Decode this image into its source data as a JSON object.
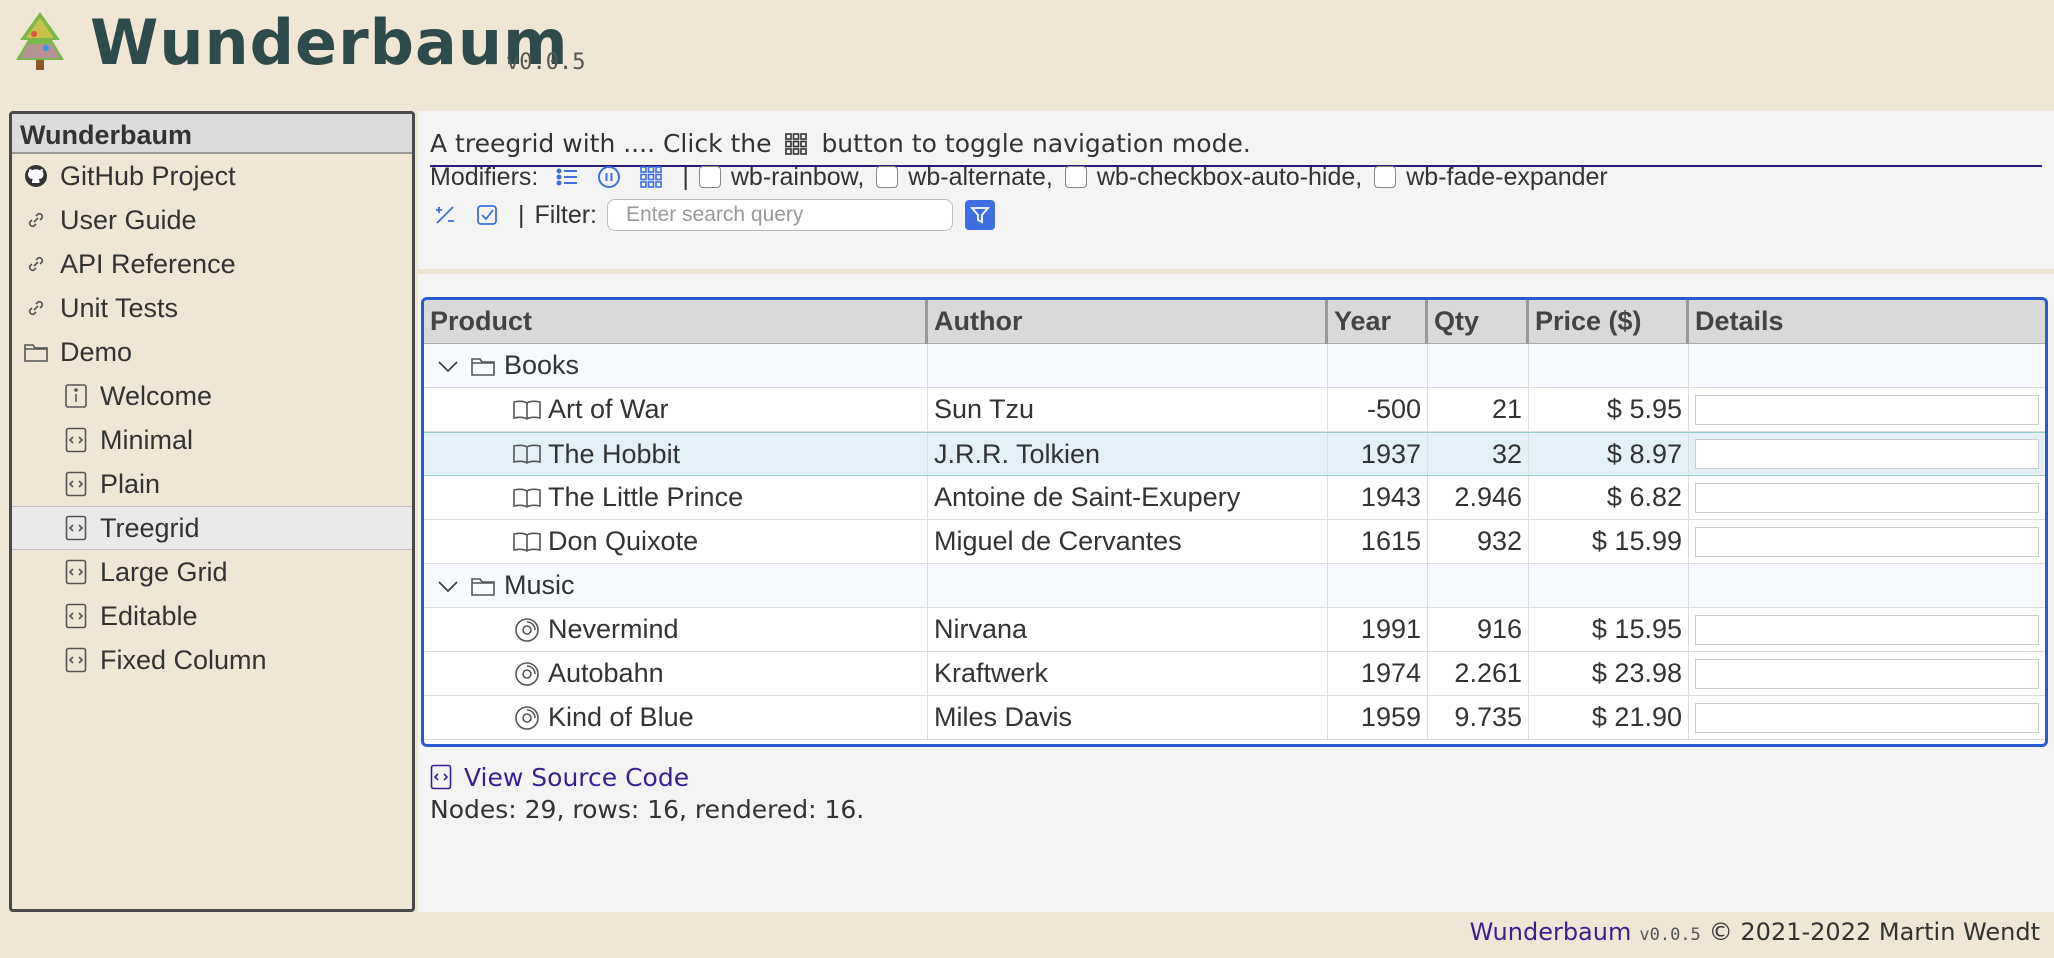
{
  "header": {
    "title": "Wunderbaum",
    "version": "v0.0.5"
  },
  "sidebar": {
    "title": "Wunderbaum",
    "items": [
      {
        "label": "GitHub Project",
        "icon": "github-icon",
        "level": 0
      },
      {
        "label": "User Guide",
        "icon": "link-icon",
        "level": 0
      },
      {
        "label": "API Reference",
        "icon": "link-icon",
        "level": 0
      },
      {
        "label": "Unit Tests",
        "icon": "link-icon",
        "level": 0
      },
      {
        "label": "Demo",
        "icon": "folder-icon",
        "level": 0
      },
      {
        "label": "Welcome",
        "icon": "info-icon",
        "level": 1
      },
      {
        "label": "Minimal",
        "icon": "code-file-icon",
        "level": 1
      },
      {
        "label": "Plain",
        "icon": "code-file-icon",
        "level": 1
      },
      {
        "label": "Treegrid",
        "icon": "code-file-icon",
        "level": 1,
        "active": true
      },
      {
        "label": "Large Grid",
        "icon": "code-file-icon",
        "level": 1
      },
      {
        "label": "Editable",
        "icon": "code-file-icon",
        "level": 1
      },
      {
        "label": "Fixed Column",
        "icon": "code-file-icon",
        "level": 1
      }
    ]
  },
  "main": {
    "intro_before": "A treegrid with .... Click the",
    "intro_after": "button to toggle navigation mode.",
    "modifiers_label": "Modifiers:",
    "separator": "|",
    "checkboxes": [
      "wb-rainbow,",
      "wb-alternate,",
      "wb-checkbox-auto-hide,",
      "wb-fade-expander"
    ],
    "filter_label": "Filter:",
    "search_placeholder": "Enter search query",
    "source_link": "View Source Code",
    "stats": "Nodes: 29, rows: 16, rendered: 16."
  },
  "grid": {
    "columns": [
      "Product",
      "Author",
      "Year",
      "Qty",
      "Price ($)",
      "Details"
    ],
    "rows": [
      {
        "type": "folder",
        "product": "Books",
        "icon": "folder-icon"
      },
      {
        "type": "item",
        "product": "Art of War",
        "author": "Sun Tzu",
        "year": "-500",
        "qty": "21",
        "price": "$ 5.95",
        "icon": "book-icon"
      },
      {
        "type": "item",
        "product": "The Hobbit",
        "author": "J.R.R. Tolkien",
        "year": "1937",
        "qty": "32",
        "price": "$ 8.97",
        "icon": "book-icon",
        "selected": true
      },
      {
        "type": "item",
        "product": "The Little Prince",
        "author": "Antoine de Saint-Exupery",
        "year": "1943",
        "qty": "2.946",
        "price": "$ 6.82",
        "icon": "book-icon"
      },
      {
        "type": "item",
        "product": "Don Quixote",
        "author": "Miguel de Cervantes",
        "year": "1615",
        "qty": "932",
        "price": "$ 15.99",
        "icon": "book-icon"
      },
      {
        "type": "folder",
        "product": "Music",
        "icon": "folder-icon"
      },
      {
        "type": "item",
        "product": "Nevermind",
        "author": "Nirvana",
        "year": "1991",
        "qty": "916",
        "price": "$ 15.95",
        "icon": "disc-icon"
      },
      {
        "type": "item",
        "product": "Autobahn",
        "author": "Kraftwerk",
        "year": "1974",
        "qty": "2.261",
        "price": "$ 23.98",
        "icon": "disc-icon"
      },
      {
        "type": "item",
        "product": "Kind of Blue",
        "author": "Miles Davis",
        "year": "1959",
        "qty": "9.735",
        "price": "$ 21.90",
        "icon": "disc-icon"
      }
    ]
  },
  "footer": {
    "brand": "Wunderbaum",
    "version": "v0.0.5",
    "copyright": "© 2021-2022 Martin Wendt"
  },
  "colors": {
    "accent": "#2b5bd0",
    "link": "#3b1f8f",
    "background": "#efe6d6"
  }
}
